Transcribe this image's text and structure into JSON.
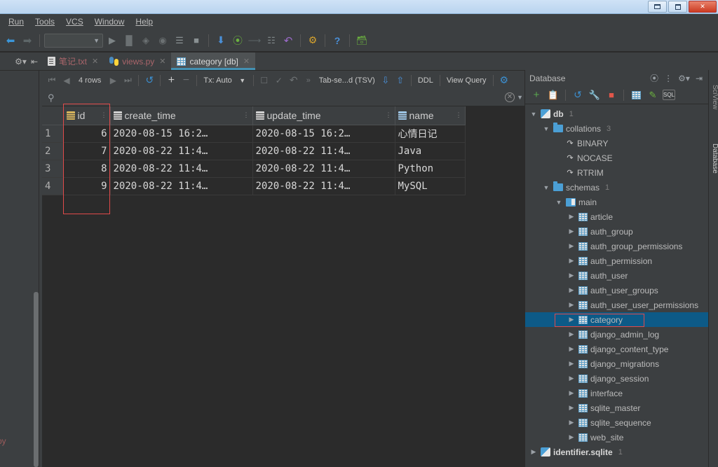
{
  "window": {
    "minimize_label": "—",
    "maximize_label": "□",
    "close_label": "✕"
  },
  "menubar": {
    "items": [
      {
        "label": "Run",
        "mnemonic": "u"
      },
      {
        "label": "Tools",
        "mnemonic": "T"
      },
      {
        "label": "VCS",
        "mnemonic": "S"
      },
      {
        "label": "Window",
        "mnemonic": "W"
      },
      {
        "label": "Help",
        "mnemonic": "H"
      }
    ]
  },
  "toolbar": {
    "back_icon": "back-arrow-icon",
    "forward_icon": "forward-arrow-icon",
    "run_config_value": "",
    "run_icon": "run-icon",
    "debug_icon": "debug-icon",
    "coverage_icon": "run-coverage-icon",
    "profile_icon": "profile-icon",
    "console_icon": "console-icon",
    "stop_icon": "stop-icon",
    "update_project_icon": "update-project-icon",
    "commit_icon": "commit-icon",
    "push_icon": "push-icon",
    "diff_icon": "diff-icon",
    "revert_icon": "revert-icon",
    "settings_icon": "settings-icon",
    "help_icon": "help-icon",
    "database_icon": "database-icon"
  },
  "editor_tabs": [
    {
      "label": "笔记.txt",
      "icon": "text-file-icon",
      "active": false,
      "closable": true
    },
    {
      "label": "views.py",
      "icon": "python-file-icon",
      "active": false,
      "closable": true
    },
    {
      "label": "category [db]",
      "icon": "table-icon",
      "active": true,
      "closable": true
    }
  ],
  "grid_toolbar": {
    "first_page_icon": "first-page-icon",
    "prev_page_icon": "prev-page-icon",
    "rows_label": "4 rows",
    "next_page_icon": "next-page-icon",
    "last_page_icon": "last-page-icon",
    "reload_icon": "reload-icon",
    "add_row_icon": "add-row-icon",
    "delete_row_icon": "delete-row-icon",
    "tx_label": "Tx: Auto",
    "tx_chevron": "chevron-down-icon",
    "commit_icon": "commit-icon",
    "rollback_icon": "rollback-icon",
    "expand_icon": "expand-icon",
    "more_icon": "chevron-double-right-icon",
    "format_label": "Tab-se...d (TSV)",
    "import_icon": "import-icon",
    "export_icon": "export-icon",
    "ddl_label": "DDL",
    "view_query_label": "View Query",
    "settings_icon": "settings-gear-icon"
  },
  "filter_bar": {
    "search_icon": "filter-search-icon",
    "value": "",
    "placeholder": "",
    "close_icon": "close-circle-icon",
    "history_icon": "chevron-down-icon"
  },
  "grid": {
    "columns": [
      {
        "name": "id",
        "icon": "primary-key-column-icon",
        "sortable": true
      },
      {
        "name": "create_time",
        "icon": "column-icon",
        "sortable": true
      },
      {
        "name": "update_time",
        "icon": "column-icon",
        "sortable": true
      },
      {
        "name": "name",
        "icon": "text-column-icon",
        "sortable": true
      }
    ],
    "rows": [
      {
        "num": "1",
        "id": "6",
        "create_time": "2020-08-15 16:2…",
        "update_time": "2020-08-15 16:2…",
        "name": "心情日记"
      },
      {
        "num": "2",
        "id": "7",
        "create_time": "2020-08-22 11:4…",
        "update_time": "2020-08-22 11:4…",
        "name": "Java"
      },
      {
        "num": "3",
        "id": "8",
        "create_time": "2020-08-22 11:4…",
        "update_time": "2020-08-22 11:4…",
        "name": "Python"
      },
      {
        "num": "4",
        "id": "9",
        "create_time": "2020-08-22 11:4…",
        "update_time": "2020-08-22 11:4…",
        "name": "MySQL"
      }
    ]
  },
  "database_panel": {
    "title": "Database",
    "header_icons": [
      {
        "name": "expand-all-icon"
      },
      {
        "name": "collapse-all-icon"
      },
      {
        "name": "settings-gear-icon"
      },
      {
        "name": "hide-panel-icon"
      }
    ],
    "toolbar_icons": [
      {
        "name": "add-data-source-icon"
      },
      {
        "name": "copy-icon"
      },
      {
        "name": "refresh-icon"
      },
      {
        "name": "data-source-properties-icon"
      },
      {
        "name": "stop-icon"
      },
      {
        "name": "table-editor-icon"
      },
      {
        "name": "modify-table-icon"
      },
      {
        "name": "sql-console-icon"
      }
    ],
    "tree": [
      {
        "label": "db",
        "badge": "1",
        "icon": "database-icon",
        "indent": 0,
        "arrow": "down",
        "bold": true,
        "selected": false
      },
      {
        "label": "collations",
        "badge": "3",
        "icon": "folder-icon",
        "indent": 1,
        "arrow": "down",
        "bold": false,
        "selected": false
      },
      {
        "label": "BINARY",
        "badge": "",
        "icon": "collation-icon",
        "indent": 2,
        "arrow": "none",
        "bold": false,
        "selected": false
      },
      {
        "label": "NOCASE",
        "badge": "",
        "icon": "collation-icon",
        "indent": 2,
        "arrow": "none",
        "bold": false,
        "selected": false
      },
      {
        "label": "RTRIM",
        "badge": "",
        "icon": "collation-icon",
        "indent": 2,
        "arrow": "none",
        "bold": false,
        "selected": false
      },
      {
        "label": "schemas",
        "badge": "1",
        "icon": "folder-icon",
        "indent": 1,
        "arrow": "down",
        "bold": false,
        "selected": false
      },
      {
        "label": "main",
        "badge": "",
        "icon": "schema-icon",
        "indent": 2,
        "arrow": "down",
        "bold": false,
        "selected": false
      },
      {
        "label": "article",
        "badge": "",
        "icon": "table-icon",
        "indent": 3,
        "arrow": "right",
        "bold": false,
        "selected": false
      },
      {
        "label": "auth_group",
        "badge": "",
        "icon": "table-icon",
        "indent": 3,
        "arrow": "right",
        "bold": false,
        "selected": false
      },
      {
        "label": "auth_group_permissions",
        "badge": "",
        "icon": "table-icon",
        "indent": 3,
        "arrow": "right",
        "bold": false,
        "selected": false
      },
      {
        "label": "auth_permission",
        "badge": "",
        "icon": "table-icon",
        "indent": 3,
        "arrow": "right",
        "bold": false,
        "selected": false
      },
      {
        "label": "auth_user",
        "badge": "",
        "icon": "table-icon",
        "indent": 3,
        "arrow": "right",
        "bold": false,
        "selected": false
      },
      {
        "label": "auth_user_groups",
        "badge": "",
        "icon": "table-icon",
        "indent": 3,
        "arrow": "right",
        "bold": false,
        "selected": false
      },
      {
        "label": "auth_user_user_permissions",
        "badge": "",
        "icon": "table-icon",
        "indent": 3,
        "arrow": "right",
        "bold": false,
        "selected": false
      },
      {
        "label": "category",
        "badge": "",
        "icon": "table-icon",
        "indent": 3,
        "arrow": "right",
        "bold": false,
        "selected": true
      },
      {
        "label": "django_admin_log",
        "badge": "",
        "icon": "table-icon",
        "indent": 3,
        "arrow": "right",
        "bold": false,
        "selected": false
      },
      {
        "label": "django_content_type",
        "badge": "",
        "icon": "table-icon",
        "indent": 3,
        "arrow": "right",
        "bold": false,
        "selected": false
      },
      {
        "label": "django_migrations",
        "badge": "",
        "icon": "table-icon",
        "indent": 3,
        "arrow": "right",
        "bold": false,
        "selected": false
      },
      {
        "label": "django_session",
        "badge": "",
        "icon": "table-icon",
        "indent": 3,
        "arrow": "right",
        "bold": false,
        "selected": false
      },
      {
        "label": "interface",
        "badge": "",
        "icon": "table-icon",
        "indent": 3,
        "arrow": "right",
        "bold": false,
        "selected": false
      },
      {
        "label": "sqlite_master",
        "badge": "",
        "icon": "table-icon",
        "indent": 3,
        "arrow": "right",
        "bold": false,
        "selected": false
      },
      {
        "label": "sqlite_sequence",
        "badge": "",
        "icon": "table-icon",
        "indent": 3,
        "arrow": "right",
        "bold": false,
        "selected": false
      },
      {
        "label": "web_site",
        "badge": "",
        "icon": "table-icon",
        "indent": 3,
        "arrow": "right",
        "bold": false,
        "selected": false
      },
      {
        "label": "identifier.sqlite",
        "badge": "1",
        "icon": "database-icon",
        "indent": 0,
        "arrow": "right",
        "bold": true,
        "selected": false
      }
    ]
  },
  "right_tool_strip": {
    "tabs": [
      {
        "label": "SciView"
      },
      {
        "label": "Database"
      }
    ]
  },
  "left_strip": {
    "settings_icon": "settings-gear-icon",
    "hide_icon": "hide-panel-icon",
    "ghost_text": "ors.py"
  },
  "colors": {
    "accent_blue": "#4391b3",
    "selection_blue": "#0d5a87",
    "highlight_red": "#e04a4a",
    "panel_bg": "#3c3f41",
    "grid_bg": "#2b2b2b",
    "text": "#bbbbbb",
    "tab_modified": "#a9656a"
  }
}
